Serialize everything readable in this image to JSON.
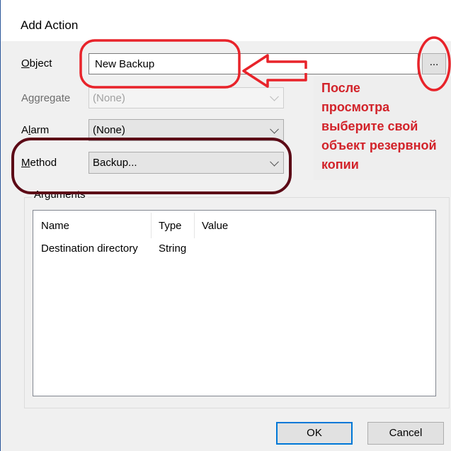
{
  "window": {
    "title": "Add Action"
  },
  "form": {
    "object": {
      "label_accel": "O",
      "label_rest": "bject",
      "value": "New Backup"
    },
    "browse_label": "...",
    "aggregate": {
      "label_first": "A",
      "label_accel": "g",
      "label_rest": "gregate",
      "value": "(None)"
    },
    "alarm": {
      "label_first": "A",
      "label_accel": "l",
      "label_rest": "arm",
      "value": "(None)"
    },
    "method": {
      "label_accel": "M",
      "label_rest": "ethod",
      "value": "Backup..."
    }
  },
  "arguments": {
    "group_label": "Arguments",
    "columns": [
      "Name",
      "Type",
      "Value"
    ],
    "rows": [
      {
        "name": "Destination directory",
        "type": "String",
        "value": ""
      }
    ]
  },
  "buttons": {
    "ok": "OK",
    "cancel": "Cancel"
  },
  "annotation": {
    "lines": [
      "После",
      "просмотра",
      "выберите свой",
      "объект резервной",
      "копии"
    ],
    "color": "#d2232a"
  },
  "highlight_colors": {
    "red": "#e8232a",
    "dark_red": "#5c0a16"
  }
}
